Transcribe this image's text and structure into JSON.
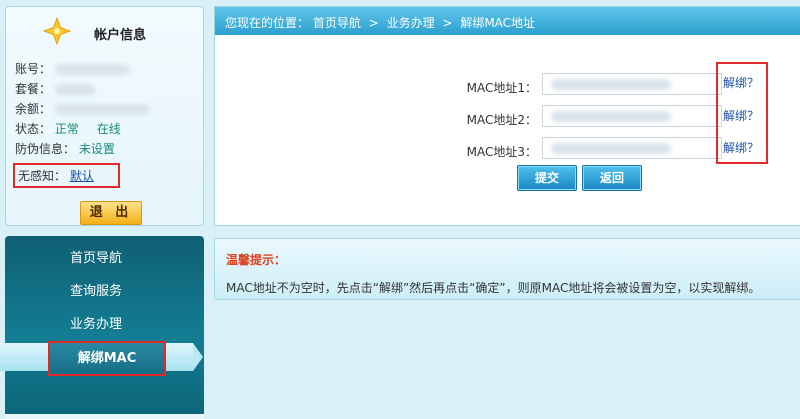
{
  "account": {
    "title": "帐户信息",
    "account_label": "账号：",
    "package_label": "套餐：",
    "balance_label": "余额：",
    "status_label": "状态：",
    "status_value": "正常",
    "online_value": "在线",
    "antitheft_label": "防伪信息：",
    "antitheft_value": "未设置",
    "noauth_label": "无感知：",
    "noauth_value": "默认",
    "logout_label": "退 出"
  },
  "nav": {
    "items": [
      "首页导航",
      "查询服务",
      "业务办理"
    ],
    "active": "解绑MAC"
  },
  "breadcrumb": {
    "prefix": "您现在的位置：",
    "items": [
      "首页导航",
      "业务办理",
      "解绑MAC地址"
    ],
    "separator": ">"
  },
  "form": {
    "mac1_label": "MAC地址1：",
    "mac2_label": "MAC地址2：",
    "mac3_label": "MAC地址3：",
    "unbind_label": "解绑？",
    "submit_label": "提交",
    "back_label": "返回"
  },
  "tip": {
    "title": "温馨提示：",
    "text": "MAC地址不为空时，先点击“解绑”然后再点击“确定”，则原MAC地址将会被设置为空，以实现解绑。"
  },
  "colors": {
    "accent": "#2da0cf",
    "nav_bg": "#137d93",
    "highlight": "#e12b2b",
    "link": "#1b4fa8",
    "tip_title": "#e0421f"
  },
  "icons": {
    "account_header": "star-icon"
  }
}
